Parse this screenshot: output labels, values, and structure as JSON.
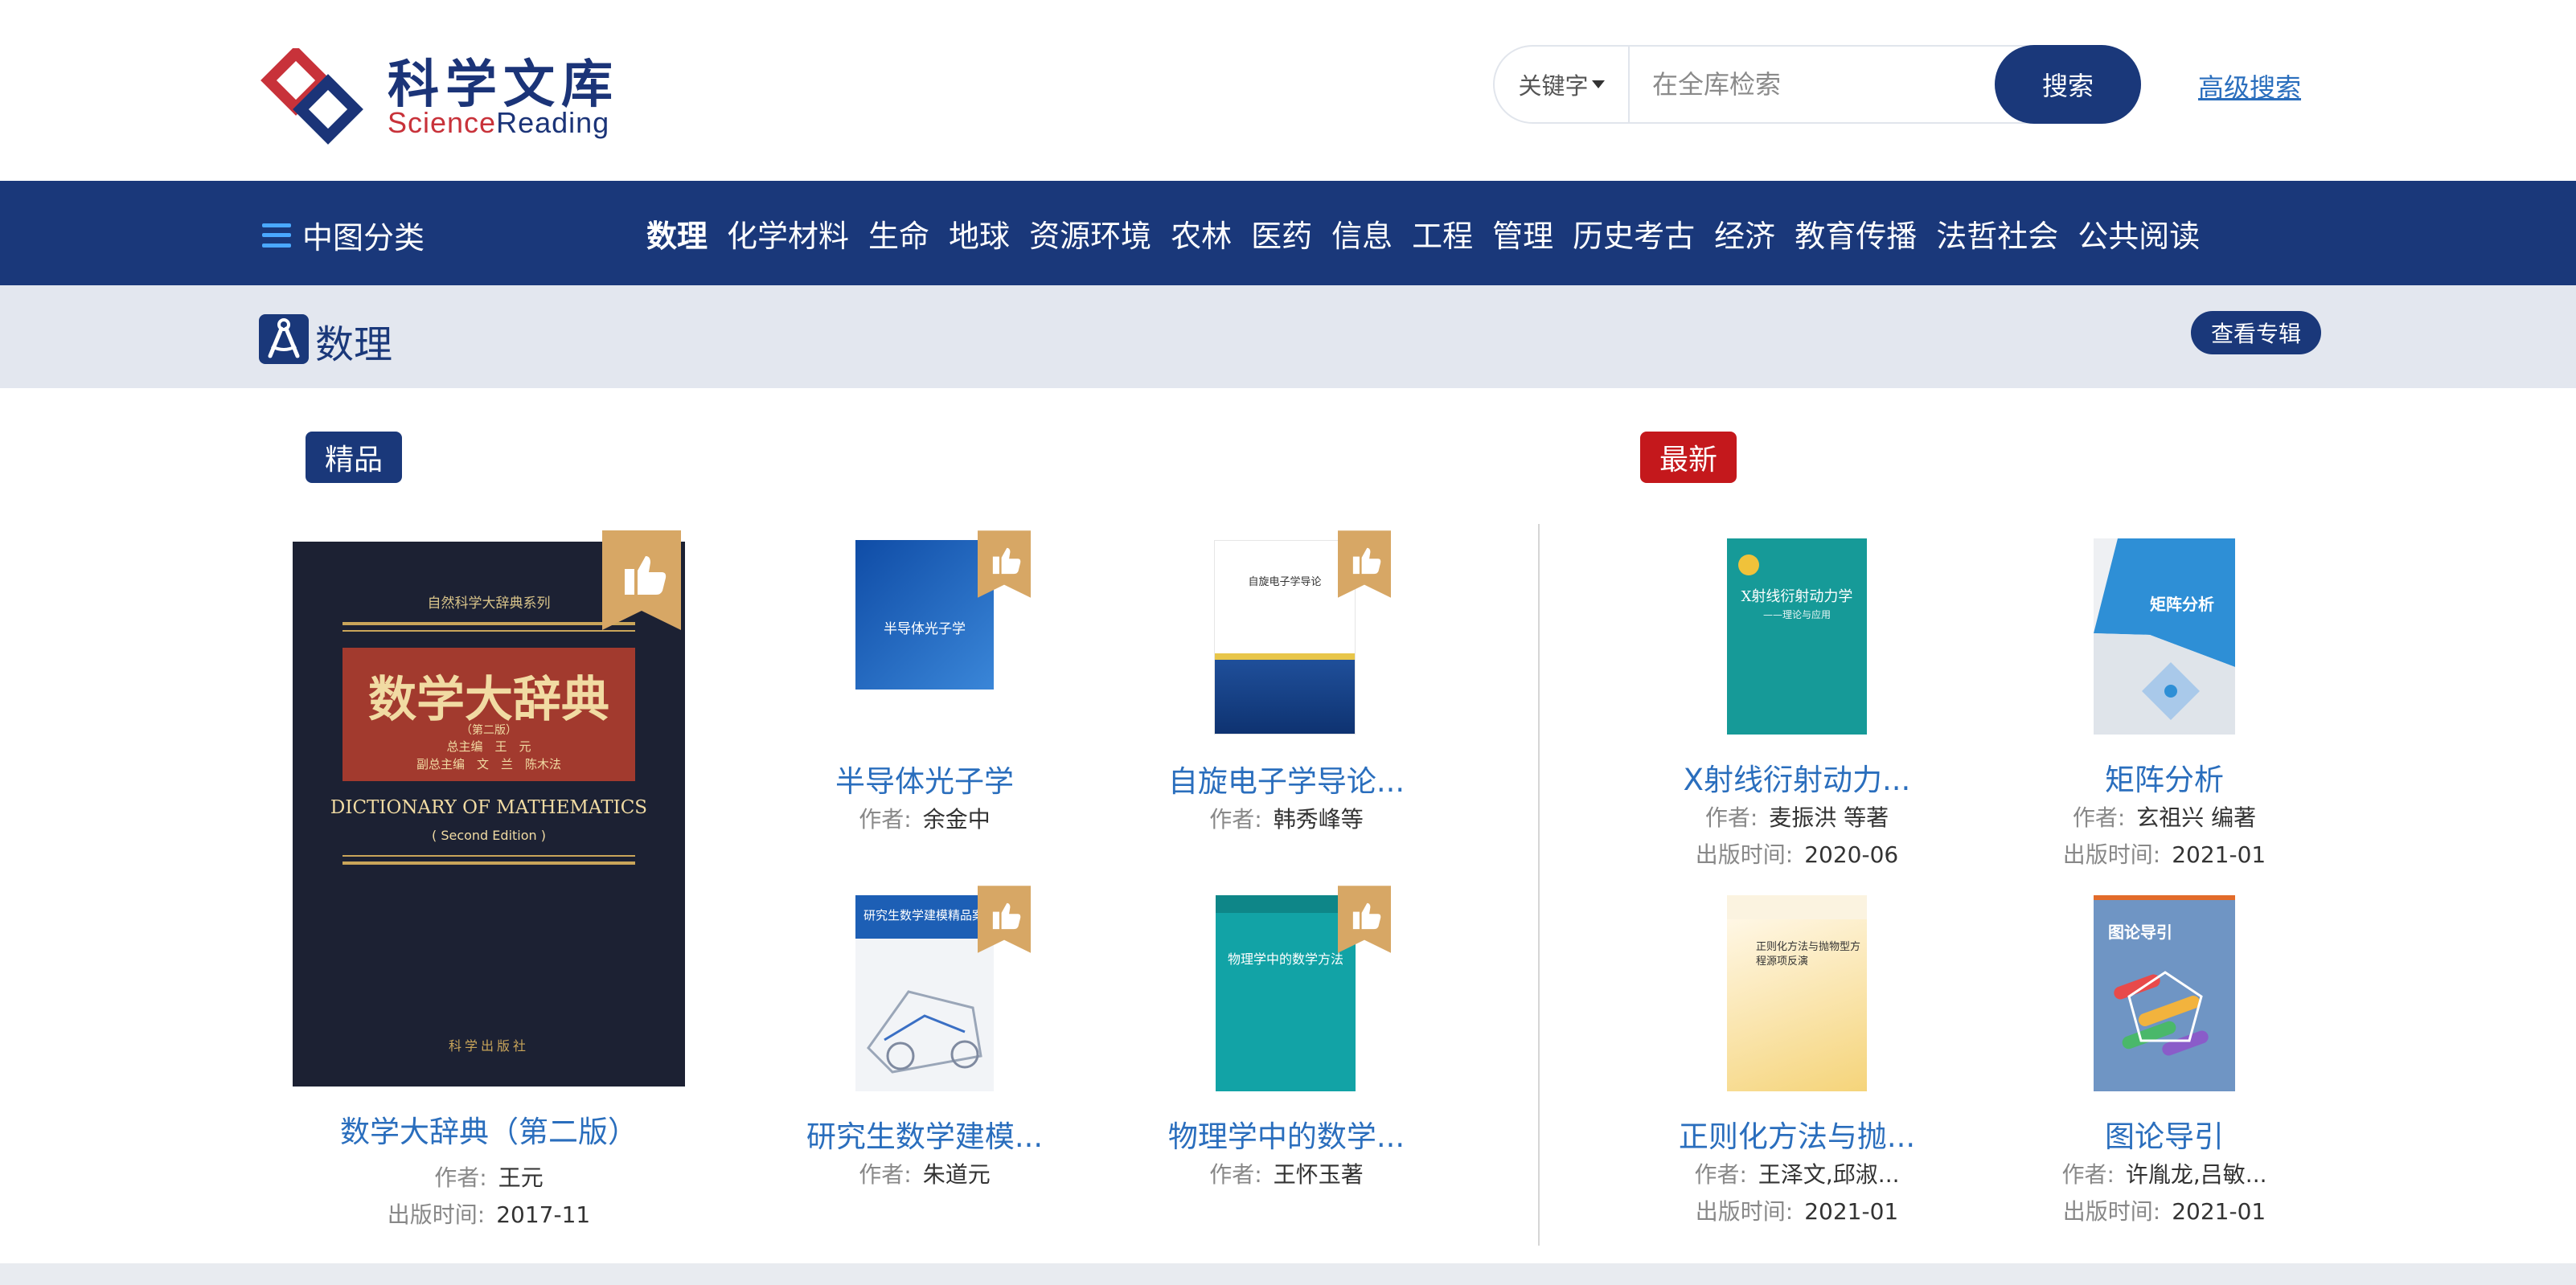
{
  "header": {
    "logo_cn": "科学文库",
    "logo_en_a": "Science",
    "logo_en_b": "Reading",
    "search_scope": "关键字",
    "search_placeholder": "在全库检索",
    "search_button": "搜索",
    "advanced_search": "高级搜索"
  },
  "nav": {
    "category_menu": "中图分类",
    "items": [
      "数理",
      "化学材料",
      "生命",
      "地球",
      "资源环境",
      "农林",
      "医药",
      "信息",
      "工程",
      "管理",
      "历史考古",
      "经济",
      "教育传播",
      "法哲社会",
      "公共阅读"
    ],
    "active_index": 0
  },
  "subject": {
    "title": "数理",
    "album_button": "查看专辑"
  },
  "featured": {
    "tag": "精品",
    "main_book": {
      "title": "数学大辞典（第二版）",
      "author_label": "作者:",
      "author": "王元",
      "date_label": "出版时间:",
      "date": "2017-11",
      "cover": {
        "series": "自然科学大辞典系列",
        "title_cn": "数学大辞典",
        "edition": "（第二版）",
        "editor_line1": "总主编　王　元",
        "editor_line2": "副总主编　文　兰　陈木法",
        "title_en": "DICTIONARY OF MATHEMATICS",
        "edition_en": "( Second Edition )",
        "publisher": "科学出版社"
      }
    },
    "books": [
      {
        "title": "半导体光子学",
        "author_label": "作者:",
        "author": "余金中",
        "cover_title": "半导体光子学"
      },
      {
        "title": "自旋电子学导论...",
        "author_label": "作者:",
        "author": "韩秀峰等",
        "cover_title": "自旋电子学导论"
      },
      {
        "title": "研究生数学建模...",
        "author_label": "作者:",
        "author": "朱道元",
        "cover_title": "研究生数学建模精品案例"
      },
      {
        "title": "物理学中的数学...",
        "author_label": "作者:",
        "author": "王怀玉著",
        "cover_title": "物理学中的数学方法"
      }
    ]
  },
  "latest": {
    "tag": "最新",
    "books": [
      {
        "title": "X射线衍射动力...",
        "author_label": "作者:",
        "author": "麦振洪 等著",
        "date_label": "出版时间:",
        "date": "2020-06",
        "cover_title": "X射线衍射动力学",
        "cover_sub": "——理论与应用"
      },
      {
        "title": "矩阵分析",
        "author_label": "作者:",
        "author": "玄祖兴 编著",
        "date_label": "出版时间:",
        "date": "2021-01",
        "cover_title": "矩阵分析"
      },
      {
        "title": "正则化方法与抛...",
        "author_label": "作者:",
        "author": "王泽文,邱淑...",
        "date_label": "出版时间:",
        "date": "2021-01",
        "cover_title": "正则化方法与抛物型方程源项反演"
      },
      {
        "title": "图论导引",
        "author_label": "作者:",
        "author": "许胤龙,吕敏...",
        "date_label": "出版时间:",
        "date": "2021-01",
        "cover_title": "图论导引"
      }
    ]
  },
  "colors": {
    "brand_navy": "#1a387a",
    "accent_red": "#c4181c",
    "link_blue": "#2a6ebd",
    "badge_gold": "#d7a765"
  }
}
